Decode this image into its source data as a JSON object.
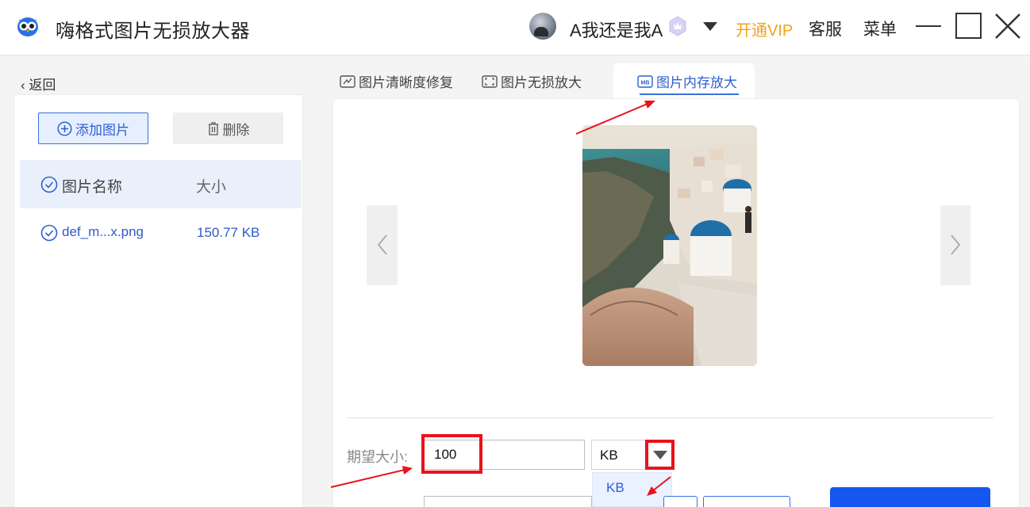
{
  "app": {
    "title": "嗨格式图片无损放大器"
  },
  "header": {
    "username": "A我还是我A",
    "vip": "开通VIP",
    "service": "客服",
    "menu": "菜单"
  },
  "left": {
    "back": "返回",
    "add_button": "添加图片",
    "delete_button": "删除",
    "columns": {
      "name": "图片名称",
      "size": "大小"
    },
    "files": [
      {
        "name": "def_m...x.png",
        "size": "150.77 KB"
      }
    ]
  },
  "tabs": [
    {
      "label": "图片清晰度修复",
      "active": false
    },
    {
      "label": "图片无损放大",
      "active": false
    },
    {
      "label": "图片内存放大",
      "active": true
    }
  ],
  "form": {
    "target_size_label": "期望大小:",
    "target_size_value": "100",
    "unit_value": "KB",
    "unit_options": [
      "KB"
    ]
  },
  "colors": {
    "accent": "#3a6fe0",
    "vip": "#f0a21c",
    "highlight": "#e8131c",
    "primary_button": "#1456f0"
  },
  "icons": {
    "tab1": "image-repair-icon",
    "tab2": "expand-icon",
    "tab3": "mb-icon"
  }
}
